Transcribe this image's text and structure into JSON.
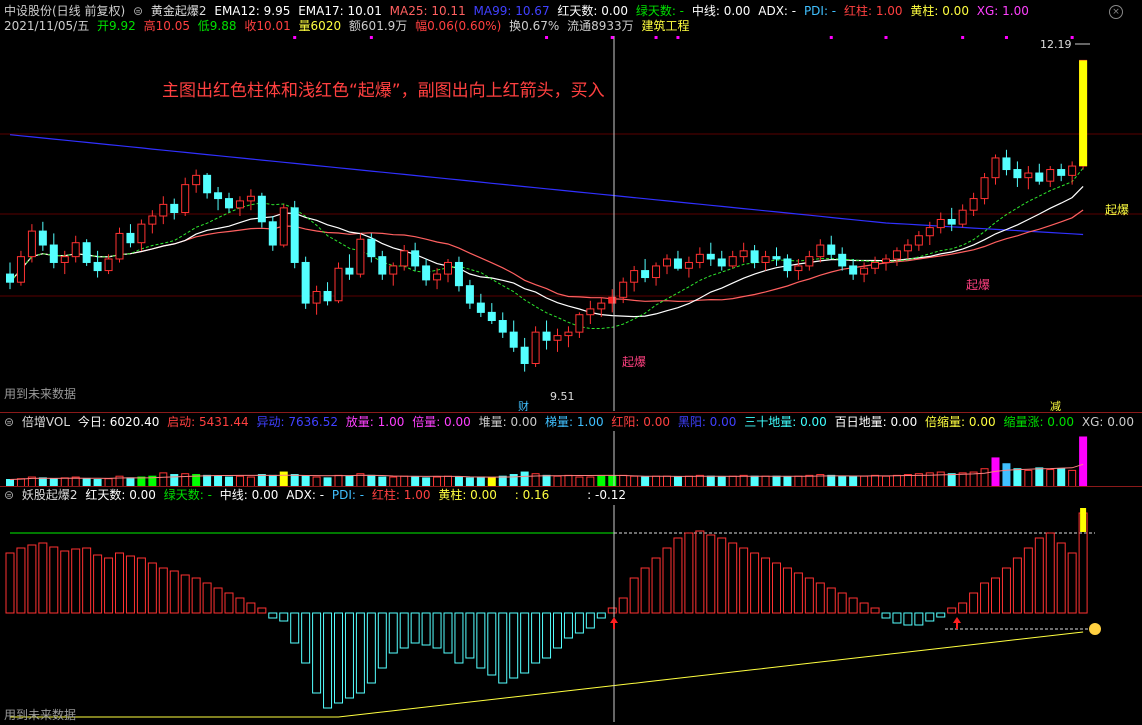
{
  "header1": {
    "stock": "中设股份(日线 前复权)",
    "indicator": "黄金起爆2",
    "ema12": "EMA12: 9.95",
    "ema17": "EMA17: 10.01",
    "ma25": "MA25: 10.11",
    "ma99": "MA99: 10.67",
    "red_days": "红天数: 0.00",
    "green_days": "绿天数: -",
    "midline": "中线: 0.00",
    "adx": "ADX: -",
    "pdi": "PDI: -",
    "red_bar": "红柱: 1.00",
    "yellow_bar": "黄柱: 0.00",
    "xg": "XG: 1.00"
  },
  "header2": {
    "date": "2021/11/05/五",
    "open": "开9.92",
    "high": "高10.05",
    "low": "低9.88",
    "close": "收10.01",
    "volume": "量6020",
    "amount": "额601.9万",
    "change": "幅0.06(0.60%)",
    "turnover": "换0.67%",
    "float": "流通8933万",
    "sector": "建筑工程"
  },
  "annotation": "主图出红色柱体和浅红色“起爆”，副图出向上红箭头，买入",
  "main_labels": {
    "price_high": "12.19",
    "price_low": "9.51",
    "qibao1": "起爆",
    "qibao2": "起爆",
    "qibao3": "起爆",
    "cai": "财",
    "jian": "减",
    "future": "用到未来数据"
  },
  "header3": {
    "name": "倍增VOL",
    "today": "今日: 6020.40",
    "qidong": "启动: 5431.44",
    "yidong": "异动: 7636.52",
    "fangliang": "放量: 1.00",
    "beiliang": "倍量: 0.00",
    "duiliang": "堆量: 0.00",
    "tiliang": "梯量: 1.00",
    "hongyang": "红阳: 0.00",
    "heiyang": "黑阳: 0.00",
    "sanshi": "三十地量: 0.00",
    "bairi": "百日地量: 0.00",
    "beisuo": "倍缩量: 0.00",
    "suoliangzhang": "缩量涨: 0.00",
    "xg": "XG: 0.00"
  },
  "header4": {
    "name": "妖股起爆2",
    "red_days": "红天数: 0.00",
    "green_days": "绿天数: -",
    "midline": "中线: 0.00",
    "adx": "ADX: -",
    "pdi": "PDI: -",
    "red_bar": "红柱: 1.00",
    "yellow_bar": "黄柱: 0.00",
    "v1": ": 0.16",
    "v2": ": -0.12",
    "future": "用到未来数据"
  },
  "colors": {
    "up": "#ff3232",
    "down": "#54ffff",
    "ema12": "#ffffff",
    "ema17": "#ffffff",
    "ma25": "#ff6060",
    "ma99": "#3030ff",
    "green_line": "#00c000",
    "yellow_line": "#ffff40",
    "magenta": "#ff00ff",
    "yellow": "#ffff00",
    "green": "#00ff00"
  },
  "chart_data": [
    {
      "type": "candlestick",
      "title": "黄金起爆2",
      "x_count": 99,
      "ylim": [
        9.3,
        12.4
      ],
      "candles": [
        [
          10.35,
          10.45,
          10.22,
          10.28
        ],
        [
          10.28,
          10.55,
          10.25,
          10.5
        ],
        [
          10.5,
          10.78,
          10.45,
          10.72
        ],
        [
          10.72,
          10.8,
          10.55,
          10.6
        ],
        [
          10.6,
          10.7,
          10.4,
          10.45
        ],
        [
          10.45,
          10.55,
          10.35,
          10.5
        ],
        [
          10.5,
          10.68,
          10.45,
          10.62
        ],
        [
          10.62,
          10.65,
          10.42,
          10.45
        ],
        [
          10.45,
          10.55,
          10.32,
          10.38
        ],
        [
          10.38,
          10.52,
          10.35,
          10.48
        ],
        [
          10.48,
          10.75,
          10.45,
          10.7
        ],
        [
          10.7,
          10.78,
          10.58,
          10.62
        ],
        [
          10.62,
          10.82,
          10.55,
          10.78
        ],
        [
          10.78,
          10.9,
          10.7,
          10.85
        ],
        [
          10.85,
          11.02,
          10.78,
          10.95
        ],
        [
          10.95,
          11.0,
          10.82,
          10.88
        ],
        [
          10.88,
          11.18,
          10.85,
          11.12
        ],
        [
          11.12,
          11.25,
          11.05,
          11.2
        ],
        [
          11.2,
          11.22,
          11.0,
          11.05
        ],
        [
          11.05,
          11.1,
          10.9,
          11.0
        ],
        [
          11.0,
          11.05,
          10.88,
          10.92
        ],
        [
          10.92,
          11.02,
          10.85,
          10.98
        ],
        [
          10.98,
          11.08,
          10.9,
          11.02
        ],
        [
          11.02,
          11.05,
          10.75,
          10.8
        ],
        [
          10.8,
          10.85,
          10.55,
          10.6
        ],
        [
          10.6,
          10.95,
          10.58,
          10.92
        ],
        [
          10.92,
          10.98,
          10.4,
          10.45
        ],
        [
          10.45,
          10.5,
          10.05,
          10.1
        ],
        [
          10.1,
          10.25,
          10.0,
          10.2
        ],
        [
          10.2,
          10.28,
          10.08,
          10.12
        ],
        [
          10.12,
          10.45,
          10.1,
          10.4
        ],
        [
          10.4,
          10.52,
          10.3,
          10.35
        ],
        [
          10.35,
          10.7,
          10.32,
          10.65
        ],
        [
          10.65,
          10.7,
          10.45,
          10.5
        ],
        [
          10.5,
          10.55,
          10.3,
          10.35
        ],
        [
          10.35,
          10.45,
          10.25,
          10.42
        ],
        [
          10.42,
          10.6,
          10.38,
          10.55
        ],
        [
          10.55,
          10.62,
          10.38,
          10.42
        ],
        [
          10.42,
          10.48,
          10.25,
          10.3
        ],
        [
          10.3,
          10.4,
          10.22,
          10.35
        ],
        [
          10.35,
          10.48,
          10.28,
          10.45
        ],
        [
          10.45,
          10.5,
          10.2,
          10.25
        ],
        [
          10.25,
          10.3,
          10.05,
          10.1
        ],
        [
          10.1,
          10.18,
          9.98,
          10.02
        ],
        [
          10.02,
          10.1,
          9.92,
          9.95
        ],
        [
          9.95,
          10.02,
          9.8,
          9.85
        ],
        [
          9.85,
          9.95,
          9.68,
          9.72
        ],
        [
          9.72,
          9.8,
          9.51,
          9.58
        ],
        [
          9.58,
          9.9,
          9.55,
          9.85
        ],
        [
          9.85,
          9.95,
          9.7,
          9.78
        ],
        [
          9.78,
          9.88,
          9.68,
          9.82
        ],
        [
          9.82,
          9.9,
          9.72,
          9.85
        ],
        [
          9.85,
          10.02,
          9.8,
          10.0
        ],
        [
          10.0,
          10.12,
          9.92,
          10.05
        ],
        [
          10.05,
          10.15,
          9.98,
          10.1
        ],
        [
          10.1,
          10.22,
          10.02,
          10.15
        ],
        [
          10.15,
          10.32,
          10.1,
          10.28
        ],
        [
          10.28,
          10.42,
          10.2,
          10.38
        ],
        [
          10.38,
          10.48,
          10.28,
          10.32
        ],
        [
          10.32,
          10.45,
          10.25,
          10.42
        ],
        [
          10.42,
          10.52,
          10.35,
          10.48
        ],
        [
          10.48,
          10.55,
          10.38,
          10.4
        ],
        [
          10.4,
          10.5,
          10.32,
          10.45
        ],
        [
          10.45,
          10.58,
          10.4,
          10.52
        ],
        [
          10.52,
          10.62,
          10.42,
          10.48
        ],
        [
          10.48,
          10.55,
          10.38,
          10.42
        ],
        [
          10.42,
          10.55,
          10.4,
          10.5
        ],
        [
          10.5,
          10.62,
          10.45,
          10.55
        ],
        [
          10.55,
          10.6,
          10.4,
          10.45
        ],
        [
          10.45,
          10.55,
          10.38,
          10.5
        ],
        [
          10.5,
          10.58,
          10.42,
          10.48
        ],
        [
          10.48,
          10.52,
          10.32,
          10.38
        ],
        [
          10.38,
          10.48,
          10.3,
          10.42
        ],
        [
          10.42,
          10.55,
          10.38,
          10.5
        ],
        [
          10.5,
          10.65,
          10.45,
          10.6
        ],
        [
          10.6,
          10.68,
          10.48,
          10.52
        ],
        [
          10.52,
          10.58,
          10.38,
          10.42
        ],
        [
          10.42,
          10.48,
          10.3,
          10.35
        ],
        [
          10.35,
          10.45,
          10.28,
          10.4
        ],
        [
          10.4,
          10.5,
          10.35,
          10.45
        ],
        [
          10.45,
          10.52,
          10.38,
          10.48
        ],
        [
          10.48,
          10.58,
          10.42,
          10.55
        ],
        [
          10.55,
          10.65,
          10.48,
          10.6
        ],
        [
          10.6,
          10.72,
          10.55,
          10.68
        ],
        [
          10.68,
          10.8,
          10.6,
          10.75
        ],
        [
          10.75,
          10.88,
          10.7,
          10.82
        ],
        [
          10.82,
          10.92,
          10.72,
          10.78
        ],
        [
          10.78,
          10.95,
          10.75,
          10.9
        ],
        [
          10.9,
          11.05,
          10.85,
          11.0
        ],
        [
          11.0,
          11.22,
          10.95,
          11.18
        ],
        [
          11.18,
          11.38,
          11.12,
          11.35
        ],
        [
          11.35,
          11.42,
          11.2,
          11.25
        ],
        [
          11.25,
          11.32,
          11.1,
          11.18
        ],
        [
          11.18,
          11.28,
          11.08,
          11.22
        ],
        [
          11.22,
          11.3,
          11.12,
          11.15
        ],
        [
          11.15,
          11.28,
          11.1,
          11.25
        ],
        [
          11.25,
          11.3,
          11.15,
          11.2
        ],
        [
          11.2,
          11.32,
          11.12,
          11.28
        ],
        [
          11.28,
          12.19,
          11.25,
          12.19
        ]
      ]
    },
    {
      "type": "bar",
      "title": "倍增VOL",
      "x_count": 99,
      "ylim": [
        0,
        6500
      ],
      "values": [
        900,
        1000,
        1200,
        1100,
        1000,
        1100,
        1200,
        1000,
        900,
        1000,
        1300,
        1100,
        1200,
        1300,
        1700,
        1500,
        1600,
        1500,
        1400,
        1300,
        1200,
        1300,
        1200,
        1500,
        1400,
        1800,
        1500,
        1300,
        1200,
        1100,
        1400,
        1300,
        1600,
        1400,
        1200,
        1200,
        1300,
        1200,
        1100,
        1200,
        1300,
        1200,
        1100,
        1200,
        1100,
        1300,
        1500,
        1800,
        1600,
        1400,
        1300,
        1400,
        1200,
        1200,
        1300,
        1300,
        1400,
        1300,
        1200,
        1300,
        1300,
        1200,
        1300,
        1400,
        1300,
        1200,
        1300,
        1400,
        1300,
        1300,
        1300,
        1200,
        1300,
        1400,
        1500,
        1400,
        1300,
        1300,
        1300,
        1400,
        1300,
        1400,
        1500,
        1600,
        1700,
        1800,
        1600,
        1700,
        1800,
        2200,
        3500,
        2800,
        2200,
        2000,
        2300,
        2100,
        2200,
        2000,
        6020
      ]
    },
    {
      "type": "bar",
      "title": "妖股起爆2",
      "x_count": 99,
      "ylim": [
        -1,
        1
      ],
      "values": [
        0.6,
        0.65,
        0.68,
        0.7,
        0.66,
        0.62,
        0.64,
        0.65,
        0.58,
        0.55,
        0.6,
        0.57,
        0.55,
        0.5,
        0.45,
        0.42,
        0.38,
        0.35,
        0.3,
        0.25,
        0.2,
        0.15,
        0.1,
        0.05,
        -0.05,
        -0.08,
        -0.3,
        -0.5,
        -0.8,
        -0.95,
        -0.9,
        -0.85,
        -0.8,
        -0.7,
        -0.55,
        -0.4,
        -0.35,
        -0.3,
        -0.32,
        -0.35,
        -0.4,
        -0.5,
        -0.45,
        -0.55,
        -0.62,
        -0.7,
        -0.65,
        -0.6,
        -0.5,
        -0.45,
        -0.35,
        -0.25,
        -0.2,
        -0.15,
        -0.05,
        0.05,
        0.15,
        0.35,
        0.45,
        0.55,
        0.65,
        0.75,
        0.8,
        0.82,
        0.78,
        0.75,
        0.7,
        0.65,
        0.6,
        0.55,
        0.5,
        0.45,
        0.4,
        0.35,
        0.3,
        0.25,
        0.2,
        0.15,
        0.1,
        0.05,
        -0.05,
        -0.1,
        -0.12,
        -0.12,
        -0.08,
        -0.04,
        0.05,
        0.1,
        0.2,
        0.3,
        0.35,
        0.45,
        0.55,
        0.65,
        0.75,
        0.8,
        0.7,
        0.6,
        1.0
      ]
    }
  ]
}
